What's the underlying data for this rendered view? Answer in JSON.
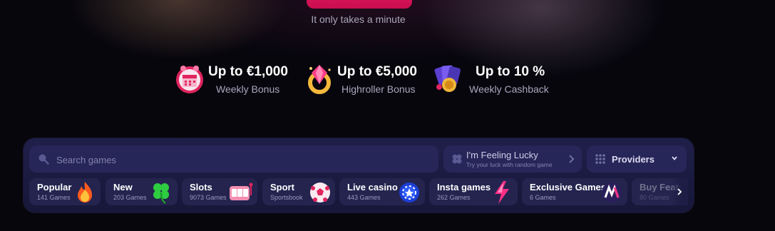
{
  "hero": {
    "subtext": "It only takes a minute"
  },
  "promos": [
    {
      "value": "Up to €1,000",
      "label": "Weekly Bonus",
      "icon": "calendar-gift-icon"
    },
    {
      "value": "Up to €5,000",
      "label": "Highroller Bonus",
      "icon": "gem-ring-icon"
    },
    {
      "value": "Up to 10 %",
      "label": "Weekly Cashback",
      "icon": "cards-chip-icon"
    }
  ],
  "search": {
    "placeholder": "Search games",
    "value": ""
  },
  "lucky": {
    "title": "I'm Feeling Lucky",
    "subtitle": "Try your luck with random game"
  },
  "providers": {
    "label": "Providers"
  },
  "categories": [
    {
      "name": "Popular",
      "count": "141 Games",
      "icon": "fire-icon"
    },
    {
      "name": "New",
      "count": "203 Games",
      "icon": "clover-icon"
    },
    {
      "name": "Slots",
      "count": "9073 Games",
      "icon": "slot-machine-icon"
    },
    {
      "name": "Sport",
      "count": "Sportsbook",
      "icon": "soccer-ball-icon"
    },
    {
      "name": "Live casino",
      "count": "443 Games",
      "icon": "poker-chip-icon"
    },
    {
      "name": "Insta games",
      "count": "262 Games",
      "icon": "lightning-icon"
    },
    {
      "name": "Exclusive Games",
      "count": "6 Games",
      "icon": "exclusive-logo-icon"
    },
    {
      "name": "Buy Feats",
      "count": "80 Games",
      "icon": ""
    }
  ],
  "colors": {
    "accent": "#e4185f",
    "panel": "#1f1f4a",
    "chip": "#24244f"
  }
}
